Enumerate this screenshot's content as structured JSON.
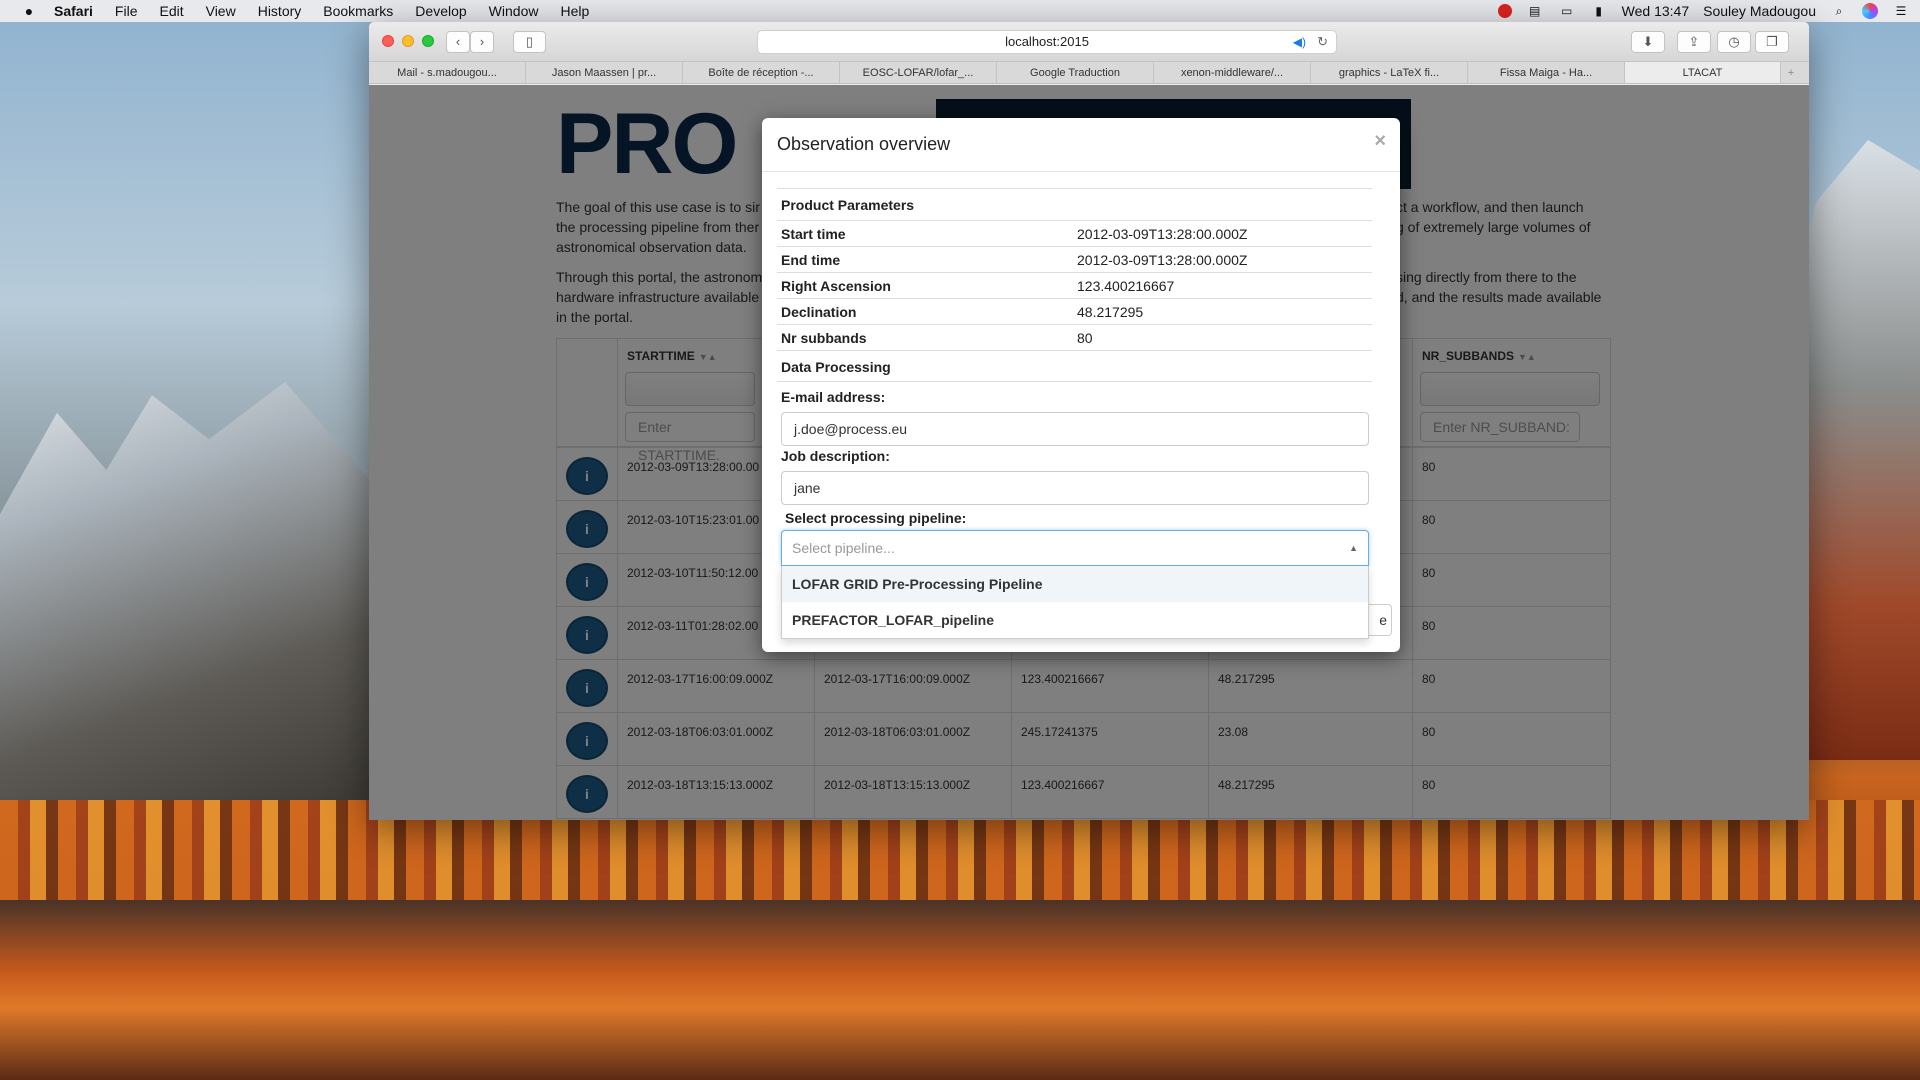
{
  "menubar": {
    "app": "Safari",
    "items": [
      "File",
      "Edit",
      "View",
      "History",
      "Bookmarks",
      "Develop",
      "Window",
      "Help"
    ],
    "clock": "Wed 13:47",
    "user": "Souley Madougou"
  },
  "browser": {
    "url": "localhost:2015",
    "tabs": [
      "Mail - s.madougou...",
      "Jason Maassen | pr...",
      "Boîte de réception -...",
      "EOSC-LOFAR/lofar_...",
      "Google Traduction",
      "xenon-middleware/...",
      "graphics - LaTeX fi...",
      "Fissa Maiga - Ha...",
      "LTACAT"
    ],
    "new_tab": "+"
  },
  "page": {
    "logo_text": "PRO",
    "intro_1": "The goal of this use case is to si… ct a workflow, and then launch the processing pipeline from the… g of extremely large volumes of astronomical observation data.",
    "intro_1a": "The goal of this use case is to sir",
    "intro_1b": "the processing pipeline from ther",
    "intro_1c": "astronomical observation data.",
    "intro_1d": "ct a workflow, and then launch",
    "intro_1e": "g of extremely large volumes of",
    "intro_2a": "Through this portal, the astronom",
    "intro_2b": "hardware infrastructure available",
    "intro_2c": "in the portal.",
    "intro_2d": "sing directly from there to the",
    "intro_2e": "d, and the results made available",
    "col_starttime": "STARTTIME",
    "col_nr_subbands": "NR_SUBBANDS",
    "filter_starttime": "Enter STARTTIME.",
    "filter_nr_subbands": "Enter NR_SUBBAND:",
    "rows": [
      {
        "start": "2012-03-09T13:28:00.00",
        "end": "",
        "ra": "",
        "dec": "",
        "nr": "80"
      },
      {
        "start": "2012-03-10T15:23:01.00",
        "end": "",
        "ra": "",
        "dec": "",
        "nr": "80"
      },
      {
        "start": "2012-03-10T11:50:12.00",
        "end": "",
        "ra": "",
        "dec": "",
        "nr": "80"
      },
      {
        "start": "2012-03-11T01:28:02.00",
        "end": "",
        "ra": "",
        "dec": "",
        "nr": "80"
      },
      {
        "start": "2012-03-17T16:00:09.000Z",
        "end": "2012-03-17T16:00:09.000Z",
        "ra": "123.400216667",
        "dec": "48.217295",
        "nr": "80"
      },
      {
        "start": "2012-03-18T06:03:01.000Z",
        "end": "2012-03-18T06:03:01.000Z",
        "ra": "245.17241375",
        "dec": "23.08",
        "nr": "80"
      },
      {
        "start": "2012-03-18T13:15:13.000Z",
        "end": "2012-03-18T13:15:13.000Z",
        "ra": "123.400216667",
        "dec": "48.217295",
        "nr": "80"
      }
    ]
  },
  "modal": {
    "title": "Observation overview",
    "close": "×",
    "product_header": "Product Parameters",
    "params": [
      {
        "key": "Start time",
        "value": "2012-03-09T13:28:00.000Z"
      },
      {
        "key": "End time",
        "value": "2012-03-09T13:28:00.000Z"
      },
      {
        "key": "Right Ascension",
        "value": "123.400216667"
      },
      {
        "key": "Declination",
        "value": "48.217295"
      },
      {
        "key": "Nr subbands",
        "value": "80"
      }
    ],
    "processing_header": "Data Processing",
    "email_label": "E-mail address:",
    "email_value": "j.doe@process.eu",
    "job_label": "Job description:",
    "job_value": "jane",
    "pipeline_label": "Select processing pipeline:",
    "pipeline_placeholder": "Select pipeline...",
    "pipeline_options": [
      "LOFAR GRID Pre-Processing Pipeline",
      "PREFACTOR_LOFAR_pipeline"
    ],
    "footer_button_partial": "e"
  }
}
